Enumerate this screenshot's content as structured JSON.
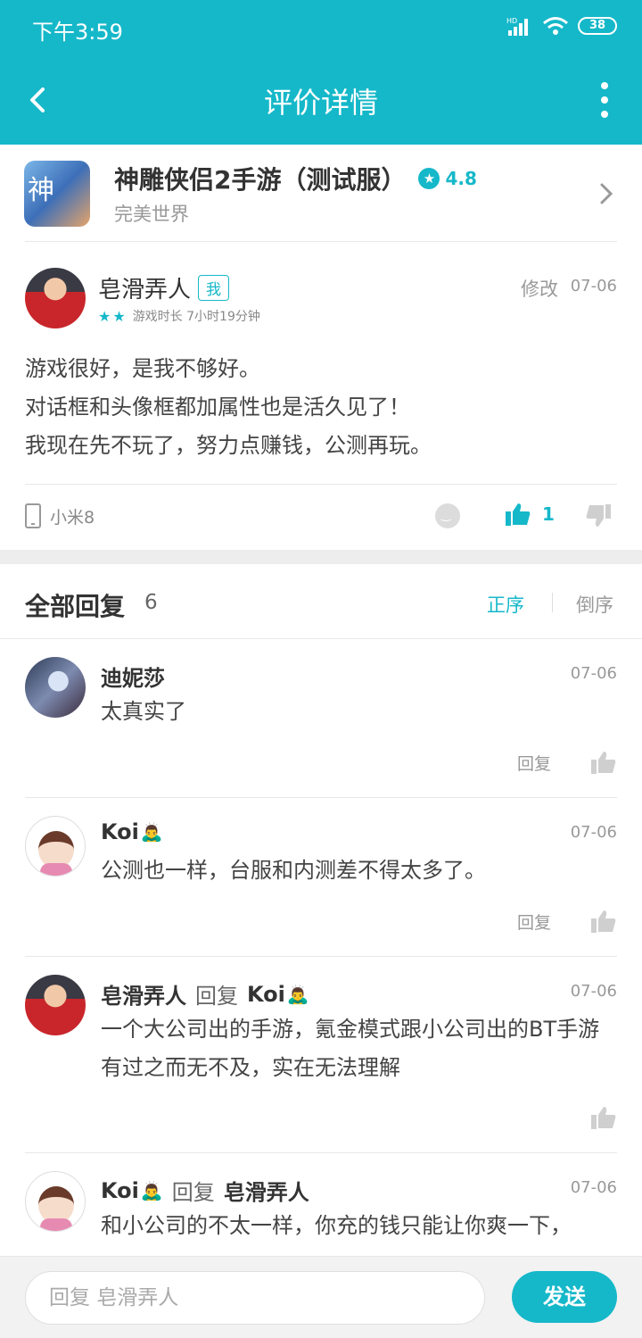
{
  "status": {
    "time": "下午3:59",
    "battery": "38"
  },
  "appbar": {
    "title": "评价详情"
  },
  "game": {
    "name": "神雕侠侣2手游（测试服）",
    "rating": "4.8",
    "developer": "完美世界"
  },
  "review": {
    "user": "皂滑弄人",
    "me_badge": "我",
    "playtime": "游戏时长 7小时19分钟",
    "edit": "修改",
    "date": "07-06",
    "lines": [
      "游戏很好，是我不够好。",
      "对话框和头像框都加属性也是活久见了！",
      "我现在先不玩了，努力点赚钱，公测再玩。"
    ],
    "device": "小米8",
    "likes": "1"
  },
  "replies_header": {
    "title": "全部回复",
    "count": "6",
    "asc": "正序",
    "desc": "倒序"
  },
  "replies": [
    {
      "user": "迪妮莎",
      "date": "07-06",
      "text": "太真实了",
      "reply_label": "回复"
    },
    {
      "user": "Koi",
      "emoji": "🙇‍♂️",
      "date": "07-06",
      "text": "公测也一样，台服和内测差不得太多了。",
      "reply_label": "回复"
    },
    {
      "user": "皂滑弄人",
      "reply_to_label": "回复",
      "target": "Koi",
      "target_emoji": "🙇‍♂️",
      "date": "07-06",
      "text": "一个大公司出的手游，氪金模式跟小公司出的BT手游有过之而无不及，实在无法理解"
    },
    {
      "user": "Koi",
      "emoji": "🙇‍♂️",
      "reply_to_label": "回复",
      "target": "皂滑弄人",
      "date": "07-06",
      "text": "和小公司的不太一样，你充的钱只能让你爽一下，"
    }
  ],
  "bottom": {
    "placeholder": "回复 皂滑弄人",
    "send": "发送"
  },
  "colors": {
    "accent": "#15b8c9"
  }
}
